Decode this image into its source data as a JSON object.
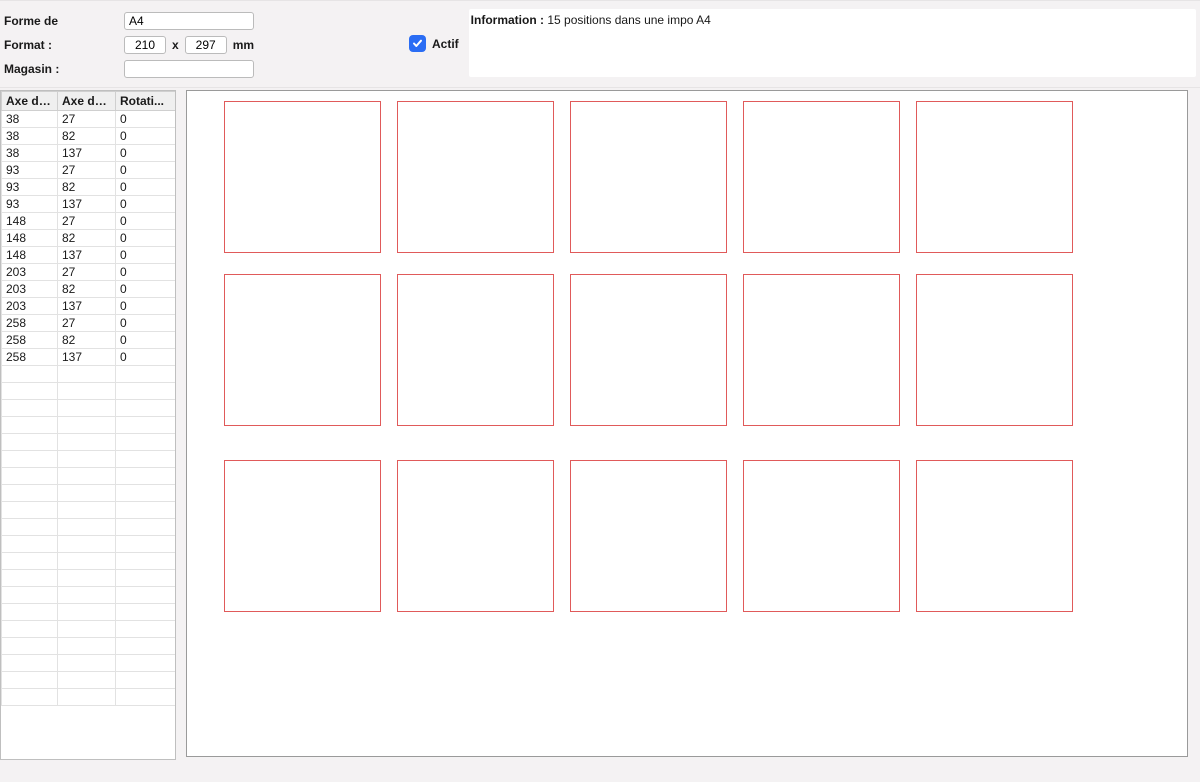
{
  "form": {
    "shape_label": "Forme de",
    "shape_value": "A4",
    "format_label": "Format :",
    "width_value": "210",
    "x_sep": "x",
    "height_value": "297",
    "unit_label": "mm",
    "magasin_label": "Magasin :",
    "magasin_value": "",
    "actif_label": "Actif",
    "actif_checked": true
  },
  "info": {
    "info_label": "Information :",
    "info_text": "15 positions dans une impo A4"
  },
  "table": {
    "columns": [
      "Axe des x",
      "Axe des y",
      "Rotati..."
    ],
    "rows": [
      [
        "38",
        "27",
        "0"
      ],
      [
        "38",
        "82",
        "0"
      ],
      [
        "38",
        "137",
        "0"
      ],
      [
        "93",
        "27",
        "0"
      ],
      [
        "93",
        "82",
        "0"
      ],
      [
        "93",
        "137",
        "0"
      ],
      [
        "148",
        "27",
        "0"
      ],
      [
        "148",
        "82",
        "0"
      ],
      [
        "148",
        "137",
        "0"
      ],
      [
        "203",
        "27",
        "0"
      ],
      [
        "203",
        "82",
        "0"
      ],
      [
        "203",
        "137",
        "0"
      ],
      [
        "258",
        "27",
        "0"
      ],
      [
        "258",
        "82",
        "0"
      ],
      [
        "258",
        "137",
        "0"
      ]
    ],
    "empty_rows": 20
  },
  "preview": {
    "columns": 5,
    "rows": 3
  }
}
